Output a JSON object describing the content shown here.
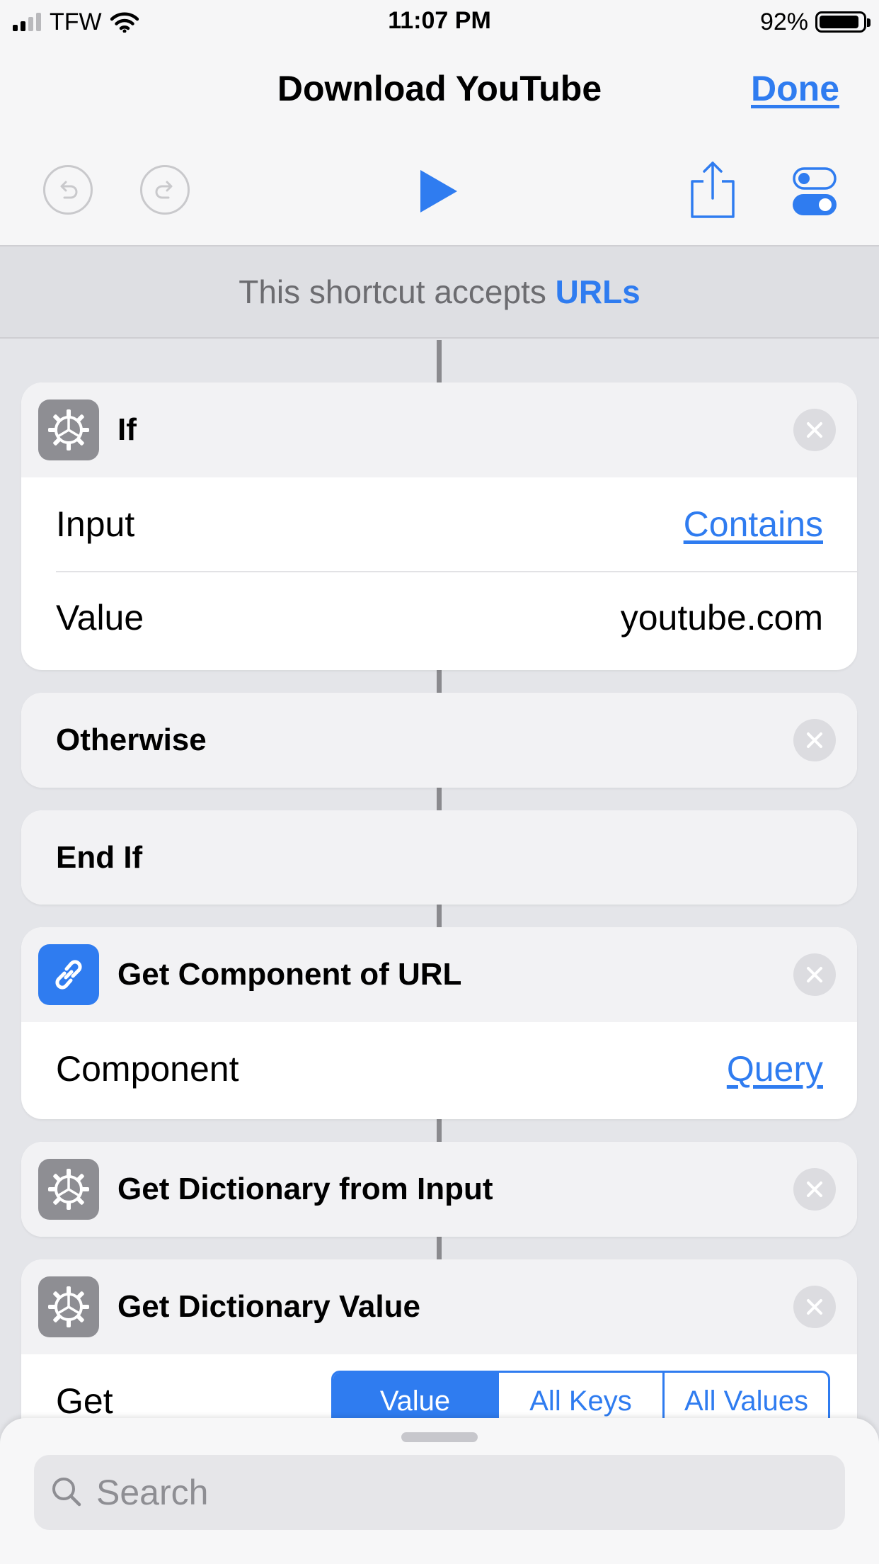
{
  "status_bar": {
    "carrier": "TFW",
    "time": "11:07 PM",
    "battery": "92%",
    "battery_level": 0.92
  },
  "nav": {
    "title": "Download YouTube",
    "done_label": "Done"
  },
  "accepts": {
    "prefix": "This shortcut accepts",
    "type": "URLs"
  },
  "actions": {
    "if": {
      "title": "If",
      "rows": [
        {
          "label": "Input",
          "value": "Contains"
        },
        {
          "label": "Value",
          "value": "youtube.com"
        }
      ]
    },
    "otherwise": {
      "title": "Otherwise"
    },
    "end_if": {
      "title": "End If"
    },
    "get_component": {
      "title": "Get Component of URL",
      "rows": [
        {
          "label": "Component",
          "value": "Query"
        }
      ]
    },
    "get_dictionary": {
      "title": "Get Dictionary from Input"
    },
    "get_dict_value": {
      "title": "Get Dictionary Value",
      "get_label": "Get",
      "segments": [
        "Value",
        "All Keys",
        "All Values"
      ],
      "selected": "Value"
    }
  },
  "search": {
    "placeholder": "Search"
  },
  "colors": {
    "accent": "#2f7cf0",
    "icon_gray": "#8e8e93"
  }
}
